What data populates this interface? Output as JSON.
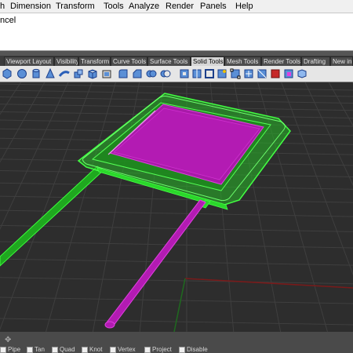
{
  "menu": [
    "h",
    "Dimension",
    "Transform",
    "Tools",
    "Analyze",
    "Render",
    "Panels",
    "Help"
  ],
  "command": {
    "history": "ncel"
  },
  "tabs": [
    "Viewport Layout",
    "Visibility",
    "Transform",
    "Curve Tools",
    "Surface Tools",
    "Solid Tools",
    "Mesh Tools",
    "Render Tools",
    "Drafting",
    "New in V"
  ],
  "active_tab": "Solid Tools",
  "toolbar_icons": [
    "box-edge-icon",
    "sphere-icon",
    "cylinder-icon",
    "cone-icon",
    "pipe-icon",
    "extrude-icon",
    "box-icon",
    "cap-icon",
    "fillet-icon",
    "chamfer-icon",
    "boolean-union-icon",
    "boolean-difference-icon",
    "boolean-intersection-icon",
    "boolean-split-icon",
    "shell-icon",
    "solid-edit-icon",
    "solid-points-icon",
    "move-face-icon",
    "split-edge-icon",
    "merge-faces-icon",
    "extract-surface-icon",
    "cube-icon"
  ],
  "osnap": [
    "Pipe",
    "Tan",
    "Quad",
    "Knot",
    "Vertex",
    "Project",
    "Disable"
  ],
  "colors": {
    "accent_green": "#2bd62b",
    "accent_magenta": "#b31bb3",
    "grid": "#3d3d3d",
    "background": "#2d2d2d"
  }
}
